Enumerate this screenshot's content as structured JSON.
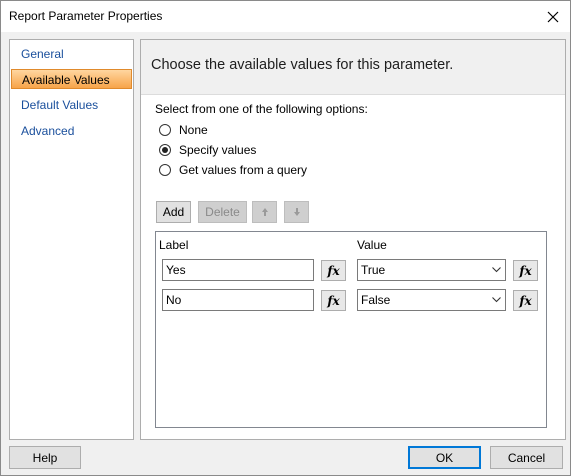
{
  "window": {
    "title": "Report Parameter Properties"
  },
  "nav": {
    "items": [
      "General",
      "Available Values",
      "Default Values",
      "Advanced"
    ]
  },
  "content": {
    "header": "Choose the available values for this parameter.",
    "options_label": "Select from one of the following options:",
    "radios": [
      {
        "label": "None",
        "checked": false
      },
      {
        "label": "Specify values",
        "checked": true
      },
      {
        "label": "Get values from a query",
        "checked": false
      }
    ],
    "toolbar": {
      "add": "Add",
      "delete": "Delete"
    },
    "grid": {
      "headers": {
        "label": "Label",
        "value": "Value"
      },
      "rows": [
        {
          "label": "Yes",
          "value": "True"
        },
        {
          "label": "No",
          "value": "False"
        }
      ],
      "fx_symbol": "fx"
    }
  },
  "footer": {
    "help": "Help",
    "ok": "OK",
    "cancel": "Cancel"
  }
}
